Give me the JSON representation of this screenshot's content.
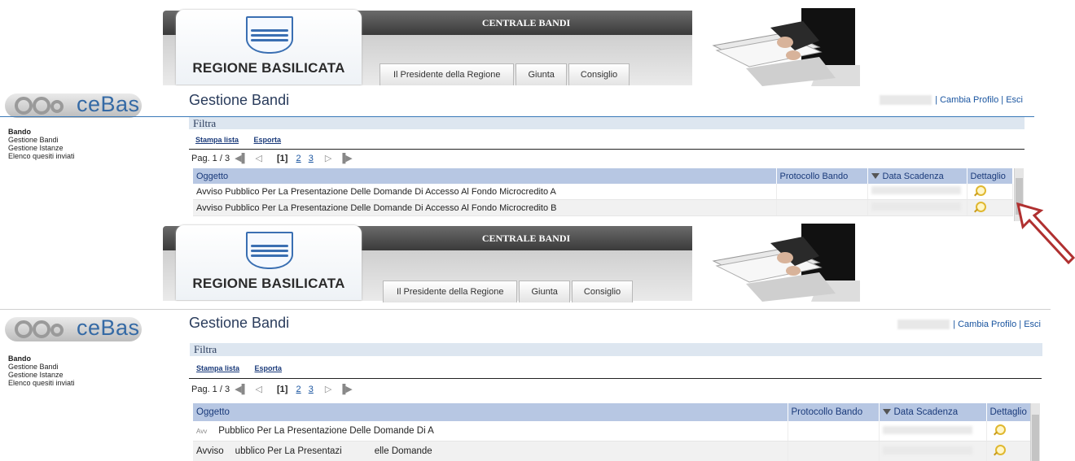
{
  "header": {
    "app_title": "CENTRALE BANDI",
    "region": "REGIONE BASILICATA",
    "tabs": [
      "Il Presidente della Regione",
      "Giunta",
      "Consiglio"
    ]
  },
  "logo": {
    "text": "ceBas"
  },
  "sidebar": {
    "items": [
      {
        "label": "Bando",
        "bold": true
      },
      {
        "label": "Gestione Bandi",
        "bold": false
      },
      {
        "label": "Gestione Istanze",
        "bold": false
      },
      {
        "label": "Elenco quesiti inviati",
        "bold": false
      }
    ]
  },
  "page": {
    "title": "Gestione Bandi",
    "change_profile": "| Cambia Profilo |",
    "logout": "Esci",
    "filter_label": "Filtra",
    "print_list": "Stampa lista",
    "export": "Esporta"
  },
  "pager": {
    "label": "Pag. 1 / 3",
    "current": "[1]",
    "pages": [
      "2",
      "3"
    ]
  },
  "table": {
    "columns": [
      "Oggetto",
      "Protocollo Bando",
      "Data Scadenza",
      "Dettaglio"
    ],
    "rows": [
      {
        "oggetto": "Avviso Pubblico Per La Presentazione Delle Domande Di Accesso Al Fondo Microcredito A",
        "protocollo": "",
        "scadenza": ""
      },
      {
        "oggetto": "Avviso Pubblico Per La Presentazione Delle Domande Di Accesso Al Fondo Microcredito B",
        "protocollo": "",
        "scadenza": ""
      }
    ]
  },
  "lower_rows": {
    "row1": "Pubblico Per La Presentazione Delle Domande Di A",
    "row2a": "Avviso",
    "row2b": "ubblico Per La Presentazi",
    "row2c": "elle Domande"
  },
  "colors": {
    "accent": "#3a79b8",
    "header_dark": "#3a3a3a",
    "table_header": "#b7c7e3",
    "arrow": "#b03030"
  }
}
